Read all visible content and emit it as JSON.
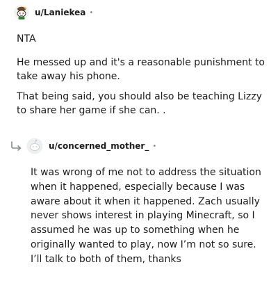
{
  "comment_1": {
    "username": "u/Laniekea",
    "separator": "•",
    "avatar_icon": "snoo-avatar-icon",
    "paragraphs": [
      "NTA",
      "He messed up and it's a reasonable punishment to take away his phone.",
      "That being said, you should also be teaching Lizzy to share her game if she can. ."
    ]
  },
  "comment_2": {
    "username": "u/concerned_mother_",
    "separator": "•",
    "avatar_icon": "default-snoo-avatar-icon",
    "reply_icon": "reply-arrow-icon",
    "paragraphs": [
      "It was wrong of me not to address the situation when it happened, especially because I was aware about it when it happened. Zach usually never shows interest in playing Minecraft, so I assumed he was up to something when he originally wanted to play, now I’m not so sure. I’ll talk to both of them, thanks"
    ]
  }
}
